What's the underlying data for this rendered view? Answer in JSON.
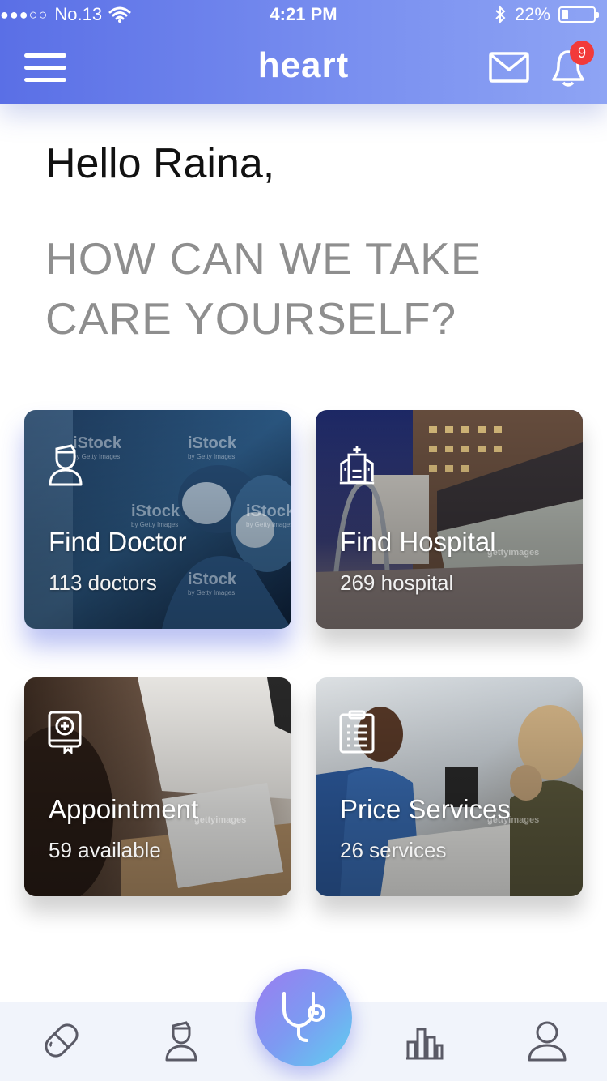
{
  "status_bar": {
    "signal": "●●●○○",
    "carrier": "No.13",
    "time": "4:21 PM",
    "battery_pct": "22%",
    "battery_level": 0.22
  },
  "header": {
    "brand": "heart",
    "notification_count": "9"
  },
  "greeting": {
    "hello": "Hello Raina,",
    "tagline": "HOW CAN WE TAKE CARE YOURSELF?"
  },
  "cards": [
    {
      "title": "Find Doctor",
      "subtitle": "113 doctors",
      "icon": "doctor-icon"
    },
    {
      "title": "Find Hospital",
      "subtitle": "269 hospital",
      "icon": "hospital-icon"
    },
    {
      "title": "Appointment",
      "subtitle": "59 available",
      "icon": "appointment-icon"
    },
    {
      "title": "Price Services",
      "subtitle": "26 services",
      "icon": "clipboard-icon"
    }
  ],
  "watermarks": {
    "istock": "iStock",
    "istock_sub": "by Getty Images",
    "getty": "gettyimages"
  },
  "tabs": [
    "pill-icon",
    "doctor-icon",
    "stethoscope-icon",
    "chart-icon",
    "user-icon"
  ],
  "colors": {
    "header_start": "#5a6fe6",
    "header_end": "#8ea4f4",
    "badge": "#f23a3a",
    "fab_start": "#9b7cf0",
    "fab_end": "#5fd0f0",
    "tagline": "#8e8e8e"
  }
}
